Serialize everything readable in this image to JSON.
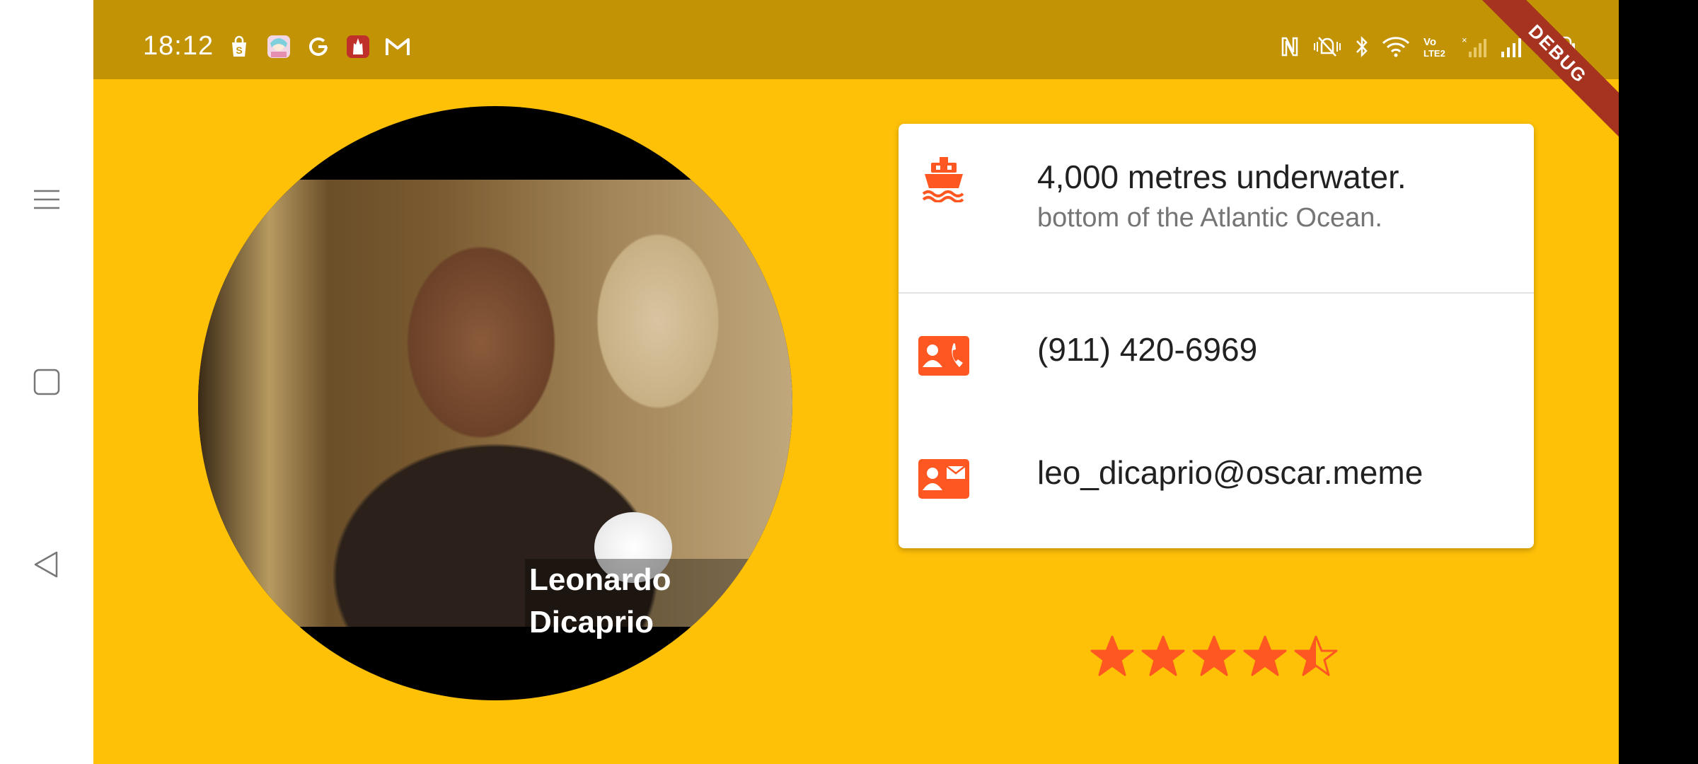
{
  "status_bar": {
    "time": "18:12",
    "battery": "100",
    "notification_icons": [
      "shopping-bag-icon",
      "anime-app-icon",
      "google-icon",
      "castle-app-icon",
      "gmail-icon"
    ],
    "system_icons": [
      "nfc-icon",
      "vibrate-icon",
      "bluetooth-icon",
      "wifi-icon",
      "volte-icon",
      "no-signal-icon",
      "signal-icon",
      "battery-icon"
    ]
  },
  "debug_banner": {
    "label": "DEBUG"
  },
  "profile": {
    "name": "Leonardo Dicaprio"
  },
  "info_card": {
    "location": {
      "icon": "boat-icon",
      "primary": "4,000 metres underwater.",
      "secondary": "bottom of the Atlantic Ocean."
    },
    "phone": {
      "icon": "contact-phone-icon",
      "value": "(911) 420-6969"
    },
    "email": {
      "icon": "contact-mail-icon",
      "value": "leo_dicaprio@oscar.meme"
    }
  },
  "rating": {
    "value": 4.5,
    "max": 5
  },
  "colors": {
    "background": "#FFC107",
    "status_bar": "#C29304",
    "accent": "#FF5722",
    "card": "#FFFFFF",
    "debug_banner": "#A5331F"
  },
  "nav_rail": {
    "buttons": [
      "menu-icon",
      "home-square-icon",
      "back-triangle-icon"
    ]
  }
}
